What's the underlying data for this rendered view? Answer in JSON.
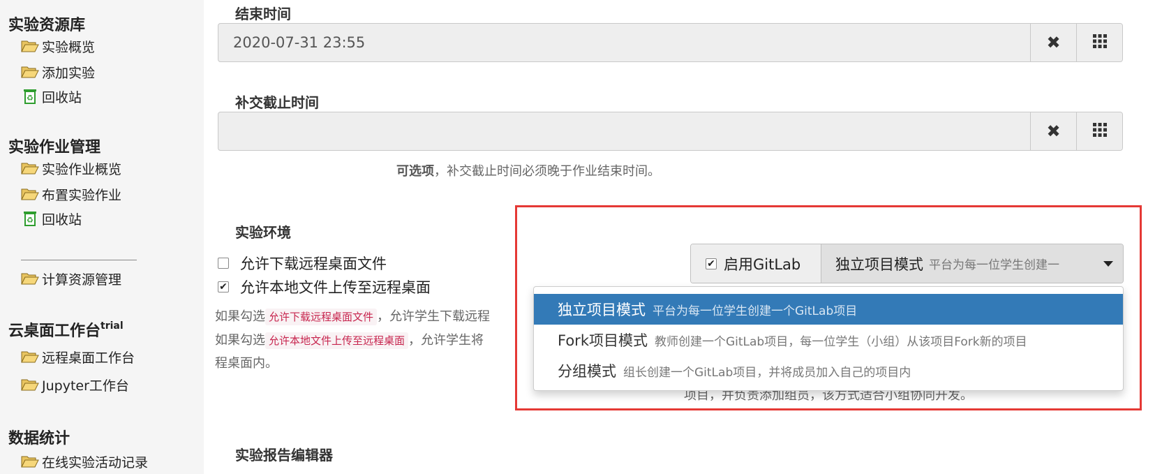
{
  "sidebar": {
    "sections": [
      {
        "title": "实验资源库",
        "items": [
          {
            "label": "实验概览",
            "icon": "folder-open-icon"
          },
          {
            "label": "添加实验",
            "icon": "folder-open-icon"
          },
          {
            "label": "回收站",
            "icon": "recycle-bin-icon"
          }
        ]
      },
      {
        "title": "实验作业管理",
        "items": [
          {
            "label": "实验作业概览",
            "icon": "folder-open-icon"
          },
          {
            "label": "布置实验作业",
            "icon": "folder-open-icon"
          },
          {
            "label": "回收站",
            "icon": "recycle-bin-icon"
          },
          {
            "label": "计算资源管理",
            "icon": "folder-open-icon"
          }
        ]
      },
      {
        "title": "云桌面工作台",
        "badge": "trial",
        "items": [
          {
            "label": "远程桌面工作台",
            "icon": "folder-open-icon"
          },
          {
            "label": "Jupyter工作台",
            "icon": "folder-open-icon"
          }
        ]
      },
      {
        "title": "数据统计",
        "items": [
          {
            "label": "在线实验活动记录",
            "icon": "folder-open-icon"
          }
        ]
      }
    ]
  },
  "form": {
    "end_time": {
      "label": "结束时间",
      "value": "2020-07-31 23:55"
    },
    "late_time": {
      "label": "补交截止时间",
      "value": "",
      "help_strong": "可选项",
      "help_text": "，补交截止时间必须晚于作业结束时间。"
    },
    "environment": {
      "label": "实验环境",
      "options": [
        {
          "label": "允许下载远程桌面文件",
          "checked": false
        },
        {
          "label": "允许本地文件上传至远程桌面",
          "checked": true
        }
      ],
      "help": [
        {
          "prefix": "如果勾选",
          "code": "允许下载远程桌面文件",
          "suffix": "，允许学生下载远程"
        },
        {
          "prefix": "如果勾选",
          "code": "允许本地文件上传至远程桌面",
          "suffix": "，允许学生将"
        },
        {
          "prefix": "程桌面内。",
          "code": "",
          "suffix": ""
        }
      ]
    },
    "gitlab": {
      "enable_label": "启用GitLab",
      "enabled": true,
      "selected_mode": "独立项目模式",
      "selected_desc": "平台为每一位学生创建一",
      "modes": [
        {
          "name": "独立项目模式",
          "desc": "平台为每一位学生创建一个GitLab项目",
          "active": true
        },
        {
          "name": "Fork项目模式",
          "desc": "教师创建一个GitLab项目，每一位学生（小组）从该项目Fork新的项目",
          "active": false
        },
        {
          "name": "分组模式",
          "desc": "组长创建一个GitLab项目，并将成员加入自己的项目内",
          "active": false
        }
      ],
      "help_tail": "项目，并负责添加组员，该方式适合小组协同开发。"
    },
    "report_editor": {
      "label": "实验报告编辑器"
    }
  },
  "colors": {
    "highlight_border": "#e53935",
    "active_item": "#337ab7",
    "code_text": "#c7254e"
  }
}
